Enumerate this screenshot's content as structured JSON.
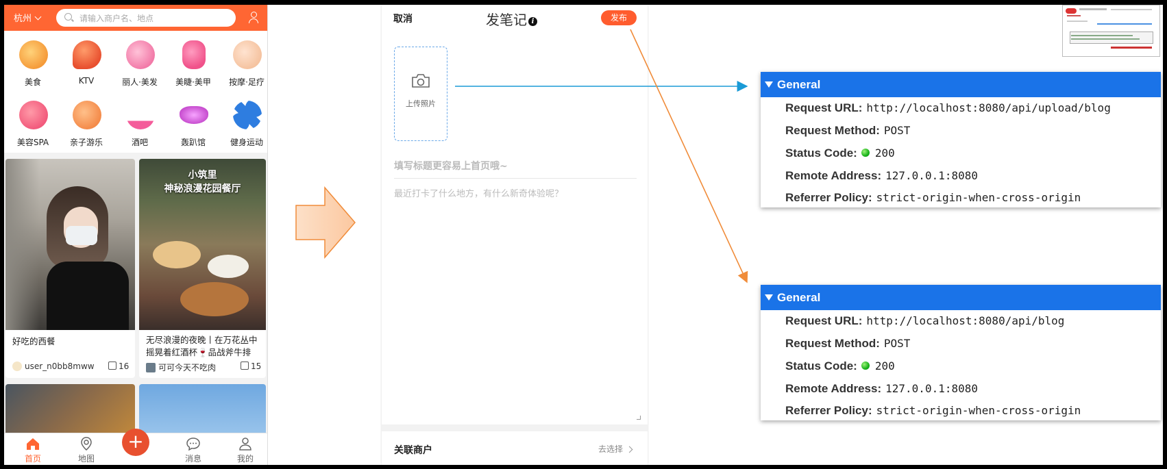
{
  "phone1": {
    "city": "杭州",
    "search_placeholder": "请输入商户名、地点",
    "categories": [
      {
        "label": "美食",
        "icon": "roast-chicken-icon",
        "color": "#f59b3a"
      },
      {
        "label": "KTV",
        "icon": "microphone-icon",
        "color": "#e8502f"
      },
      {
        "label": "丽人·美发",
        "icon": "hair-salon-icon",
        "color": "#f27aa8"
      },
      {
        "label": "美睫·美甲",
        "icon": "nail-icon",
        "color": "#f0528a"
      },
      {
        "label": "按摩·足疗",
        "icon": "massage-icon",
        "color": "#f5c3a0"
      },
      {
        "label": "美容SPA",
        "icon": "face-mask-icon",
        "color": "#f25a7c"
      },
      {
        "label": "亲子游乐",
        "icon": "family-icon",
        "color": "#f48b4a"
      },
      {
        "label": "酒吧",
        "icon": "cocktail-icon",
        "color": "#f45c9a"
      },
      {
        "label": "轰趴馆",
        "icon": "party-mask-icon",
        "color": "#c84fd0"
      },
      {
        "label": "健身运动",
        "icon": "dumbbell-icon",
        "color": "#2e7de0"
      }
    ],
    "cards": [
      {
        "title": "好吃的西餐",
        "author": "user_n0bb8mww",
        "likes": "16"
      },
      {
        "title": "无尽浪漫的夜晚丨在万花丛中摇晃着红酒杯🍷品战斧牛排",
        "author": "可可今天不吃肉",
        "likes": "15",
        "image_text_1": "小筑里",
        "image_text_2": "神秘浪漫花园餐厅"
      }
    ],
    "tabs": [
      {
        "label": "首页",
        "icon": "home-icon",
        "active": true
      },
      {
        "label": "地图",
        "icon": "map-pin-icon",
        "active": false
      },
      {
        "label": "消息",
        "icon": "chat-icon",
        "active": false
      },
      {
        "label": "我的",
        "icon": "user-icon",
        "active": false
      }
    ]
  },
  "phone2": {
    "cancel": "取消",
    "title": "发笔记",
    "publish": "发布",
    "upload_label": "上传照片",
    "title_placeholder": "填写标题更容易上首页哦~",
    "body_placeholder": "最近打卡了什么地方，有什么新奇体验呢？",
    "shop_label": "关联商户",
    "choose": "去选择"
  },
  "requests": [
    {
      "section": "General",
      "url_key": "Request URL:",
      "url": "http://localhost:8080/api/upload/blog",
      "method_key": "Request Method:",
      "method": "POST",
      "status_key": "Status Code:",
      "status": "200",
      "remote_key": "Remote Address:",
      "remote": "127.0.0.1:8080",
      "referrer_key": "Referrer Policy:",
      "referrer": "strict-origin-when-cross-origin"
    },
    {
      "section": "General",
      "url_key": "Request URL:",
      "url": "http://localhost:8080/api/blog",
      "method_key": "Request Method:",
      "method": "POST",
      "status_key": "Status Code:",
      "status": "200",
      "remote_key": "Remote Address:",
      "remote": "127.0.0.1:8080",
      "referrer_key": "Referrer Policy:",
      "referrer": "strict-origin-when-cross-origin"
    }
  ],
  "colors": {
    "brand": "#ff6633",
    "panel_header": "#1a73e8",
    "connector_blue": "#1a9ad6",
    "connector_orange": "#f08c3a"
  }
}
